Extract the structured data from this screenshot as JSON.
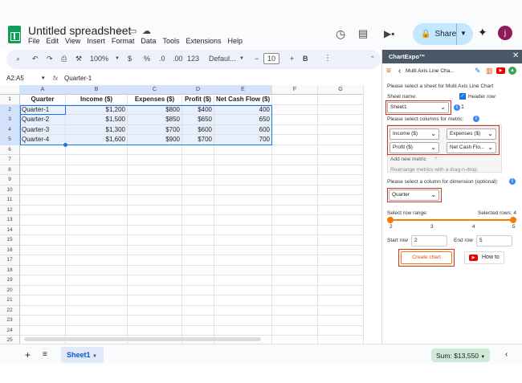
{
  "app": {
    "title": "Untitled spreadsheet",
    "share_label": "Share",
    "avatar_letter": "j"
  },
  "menu": [
    "File",
    "Edit",
    "View",
    "Insert",
    "Format",
    "Data",
    "Tools",
    "Extensions",
    "Help"
  ],
  "toolbar": {
    "zoom": "100%",
    "currency": "$",
    "percent": "%",
    "decimal_dec": ".0",
    "decimal_inc": ".00",
    "number_format": "123",
    "font": "Defaul...",
    "font_size": "10",
    "minus": "−",
    "plus": "+",
    "bold": "B"
  },
  "formula_bar": {
    "name_box": "A2:A5",
    "fx": "fx",
    "content": "Quarter-1"
  },
  "columns": [
    "A",
    "B",
    "C",
    "D",
    "E",
    "F",
    "G"
  ],
  "rows": [
    "1",
    "2",
    "3",
    "4",
    "5",
    "6",
    "7",
    "8",
    "9",
    "10",
    "11",
    "12",
    "13",
    "14",
    "15",
    "16",
    "17",
    "18",
    "19",
    "20",
    "21",
    "22",
    "23",
    "24",
    "25"
  ],
  "table": {
    "headers": [
      "Quarter",
      "Income ($)",
      "Expenses ($)",
      "Profit ($)",
      "Net Cash Flow ($)"
    ],
    "data": [
      [
        "Quarter-1",
        "$1,200",
        "$800",
        "$400",
        "400"
      ],
      [
        "Quarter-2",
        "$1,500",
        "$850",
        "$650",
        "650"
      ],
      [
        "Quarter-3",
        "$1,300",
        "$700",
        "$600",
        "600"
      ],
      [
        "Quarter-4",
        "$1,600",
        "$900",
        "$700",
        "700"
      ]
    ]
  },
  "bottom": {
    "add": "+",
    "sheet_tab": "Sheet1",
    "sum": "Sum: $13,550"
  },
  "panel": {
    "title": "ChartExpo™",
    "chart_name": "Multi Axis Line Cha...",
    "select_sheet_label": "Please select a sheet for Multi Axis Line Chart",
    "sheet_name_label": "Sheet name:",
    "sheet_value": "Sheet1",
    "header_row_label": "Header row:",
    "header_row_value": "1",
    "metric_label": "Please select columns for metric:",
    "metrics": [
      "Income ($)",
      "Expenses ($)",
      "Profit ($)",
      "Net Cash Flo..."
    ],
    "add_metric": "Add new metric",
    "rearrange": "Rearrange metrics with a drag-n-drop.",
    "dimension_label": "Please select a column for dimension (optional):",
    "dimension_value": "Quarter",
    "row_range_label": "Select row range:",
    "selected_rows": "Selected rows: 4",
    "ticks": [
      "2",
      "3",
      "4",
      "5"
    ],
    "start_row_label": "Start row",
    "start_row": "2",
    "end_row_label": "End row",
    "end_row": "5",
    "create_chart": "Create chart",
    "how_to": "How to"
  }
}
